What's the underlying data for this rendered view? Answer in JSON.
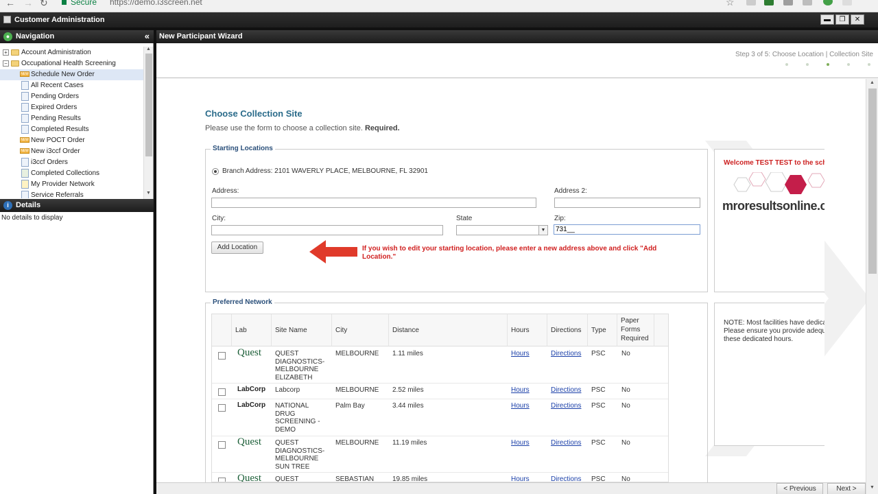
{
  "browser": {
    "secure_label": "Secure",
    "url": "https://demo.i3screen.net"
  },
  "app": {
    "title": "Customer Administration"
  },
  "navigation": {
    "header": "Navigation",
    "collapse_icon": "«",
    "items": [
      {
        "label": "Account Administration"
      },
      {
        "label": "Occupational Health Screening"
      },
      {
        "label": "Schedule New Order"
      },
      {
        "label": "All Recent Cases"
      },
      {
        "label": "Pending Orders"
      },
      {
        "label": "Expired Orders"
      },
      {
        "label": "Pending Results"
      },
      {
        "label": "Completed Results"
      },
      {
        "label": "New POCT Order"
      },
      {
        "label": "New i3ccf Order"
      },
      {
        "label": "i3ccf Orders"
      },
      {
        "label": "Completed Collections"
      },
      {
        "label": "My Provider Network"
      },
      {
        "label": "Service Referrals"
      }
    ]
  },
  "details": {
    "header": "Details",
    "empty_text": "No details to display"
  },
  "wizard": {
    "header": "New Participant Wizard",
    "step_text": "Step 3 of 5: Choose Location | Collection Site",
    "title": "Choose Collection Site",
    "subtitle": "Please use the form to choose a collection site.",
    "required": "Required."
  },
  "starting_locations": {
    "legend": "Starting Locations",
    "branch_address": "Branch Address: 2101 WAVERLY PLACE, MELBOURNE, FL 32901",
    "address_label": "Address:",
    "address2_label": "Address 2:",
    "city_label": "City:",
    "state_label": "State",
    "zip_label": "Zip:",
    "zip_value": "731__",
    "add_location_button": "Add Location",
    "warning_line1": "If you wish to edit your starting location, please enter a new address above and click \"Add",
    "warning_line2": "Location.\""
  },
  "promo": {
    "welcome": "Welcome TEST TEST to the sch",
    "logo": "mroresultsonline.c",
    "note_line1": "NOTE: Most facilities have dedicat",
    "note_line2": "Please ensure you provide adequa",
    "note_line3": "these dedicated hours."
  },
  "preferred_network": {
    "legend": "Preferred Network",
    "columns": [
      "Lab",
      "Site Name",
      "City",
      "Distance",
      "Hours",
      "Directions",
      "Type",
      "Paper",
      "Forms",
      "Required"
    ],
    "rows": [
      {
        "lab": "Quest",
        "site": [
          "QUEST",
          "DIAGNOSTICS-",
          "MELBOURNE",
          "ELIZABETH"
        ],
        "city": "MELBOURNE",
        "distance": "1.11 miles",
        "hours": "Hours",
        "directions": "Directions",
        "type": "PSC",
        "paper": "No"
      },
      {
        "lab": "LabCorp",
        "site": [
          "Labcorp"
        ],
        "city": "MELBOURNE",
        "distance": "2.52 miles",
        "hours": "Hours",
        "directions": "Directions",
        "type": "PSC",
        "paper": "No"
      },
      {
        "lab": "LabCorp",
        "site": [
          "NATIONAL",
          "DRUG",
          "SCREENING -",
          "DEMO"
        ],
        "city": "Palm Bay",
        "distance": "3.44 miles",
        "hours": "Hours",
        "directions": "Directions",
        "type": "PSC",
        "paper": "No"
      },
      {
        "lab": "Quest",
        "site": [
          "QUEST",
          "DIAGNOSTICS-",
          "MELBOURNE",
          "SUN TREE"
        ],
        "city": "MELBOURNE",
        "distance": "11.19 miles",
        "hours": "Hours",
        "directions": "Directions",
        "type": "PSC",
        "paper": "No"
      },
      {
        "lab": "Quest",
        "site": [
          "QUEST"
        ],
        "city": "SEBASTIAN",
        "distance": "19.85 miles",
        "hours": "Hours",
        "directions": "Directions",
        "type": "PSC",
        "paper": "No"
      }
    ]
  },
  "footer": {
    "previous": "< Previous",
    "next": "Next >"
  },
  "colors": {
    "accent_title": "#2a6b8a",
    "warning": "#d01f1f",
    "arrow": "#e03a2a",
    "link": "#1a3fa8"
  }
}
